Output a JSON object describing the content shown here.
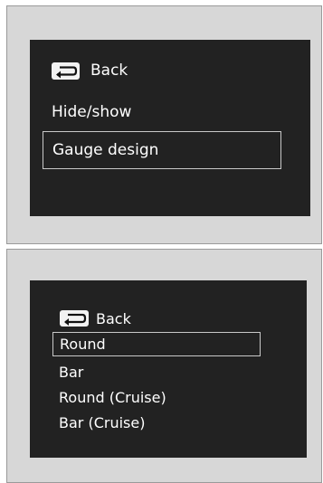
{
  "screen1": {
    "back_label": "Back",
    "items": [
      {
        "label": "Hide/show"
      },
      {
        "label": "Gauge design",
        "selected": true
      }
    ]
  },
  "screen2": {
    "back_label": "Back",
    "items": [
      {
        "label": "Round",
        "selected": true
      },
      {
        "label": "Bar"
      },
      {
        "label": "Round (Cruise)"
      },
      {
        "label": "Bar (Cruise)"
      }
    ]
  },
  "icons": {
    "back": "back-arrow-icon"
  },
  "colors": {
    "screen_bg": "#222222",
    "panel_bg": "#d7d7d7",
    "text": "#ffffff",
    "selection_border": "#c9c9c9"
  }
}
